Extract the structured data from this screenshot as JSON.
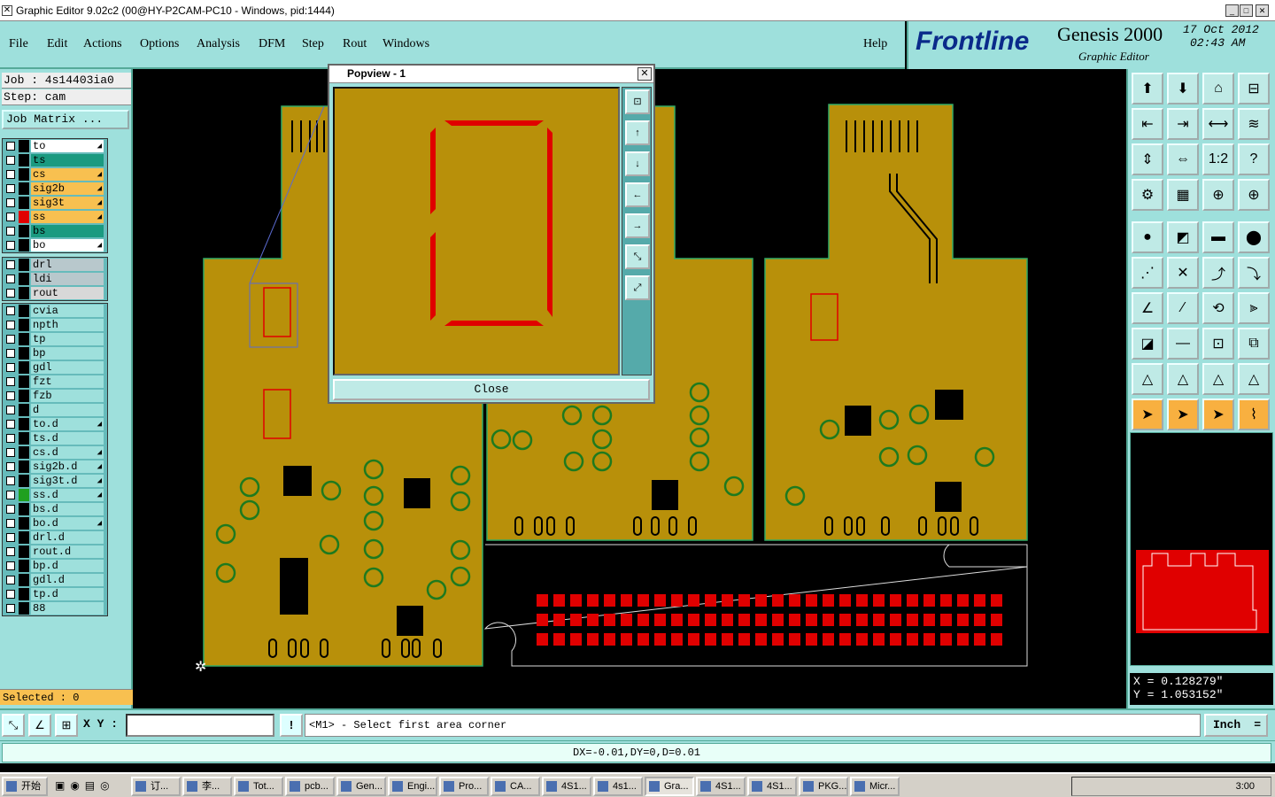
{
  "window": {
    "title": "Graphic Editor 9.02c2 (00@HY-P2CAM-PC10 - Windows, pid:1444)"
  },
  "menu": {
    "items": [
      "File",
      "Edit",
      "Actions",
      "Options",
      "Analysis",
      "DFM",
      "Step",
      "Rout",
      "Windows"
    ],
    "help": "Help"
  },
  "logo": {
    "brand": "Frontline",
    "product": "Genesis 2000",
    "subtitle": "Graphic Editor",
    "date": "17 Oct 2012",
    "time": "02:43 AM"
  },
  "job": {
    "job_label": "Job : 4s14403ia0",
    "step_label": "Step: cam",
    "matrix_button": "Job Matrix ..."
  },
  "layers": {
    "group1": [
      {
        "name": "to",
        "color": "#ffffff",
        "swatch": "#000000",
        "arrow": true
      },
      {
        "name": "ts",
        "color": "#1a9a80",
        "swatch": "#000000",
        "arrow": false
      },
      {
        "name": "cs",
        "color": "#f8c050",
        "swatch": "#000000",
        "arrow": true
      },
      {
        "name": "sig2b",
        "color": "#f8c050",
        "swatch": "#000000",
        "arrow": true
      },
      {
        "name": "sig3t",
        "color": "#f8c050",
        "swatch": "#000000",
        "arrow": true
      },
      {
        "name": "ss",
        "color": "#f8c050",
        "swatch": "#e00000",
        "arrow": true
      },
      {
        "name": "bs",
        "color": "#1a9a80",
        "swatch": "#000000",
        "arrow": false
      },
      {
        "name": "bo",
        "color": "#ffffff",
        "swatch": "#000000",
        "arrow": true
      }
    ],
    "group2": [
      {
        "name": "drl",
        "color": "#b8c8cc",
        "swatch": "#000000",
        "arrow": false
      },
      {
        "name": "ldi",
        "color": "#b8c8cc",
        "swatch": "#000000",
        "arrow": false
      },
      {
        "name": "rout",
        "color": "#d8d8d8",
        "swatch": "#000000",
        "arrow": false
      }
    ],
    "group3": [
      {
        "name": "cvia",
        "color": "#9ee0dc",
        "swatch": "#000000",
        "arrow": false
      },
      {
        "name": "npth",
        "color": "#9ee0dc",
        "swatch": "#000000",
        "arrow": false
      },
      {
        "name": "tp",
        "color": "#9ee0dc",
        "swatch": "#000000",
        "arrow": false
      },
      {
        "name": "bp",
        "color": "#9ee0dc",
        "swatch": "#000000",
        "arrow": false
      },
      {
        "name": "gdl",
        "color": "#9ee0dc",
        "swatch": "#000000",
        "arrow": false
      },
      {
        "name": "fzt",
        "color": "#9ee0dc",
        "swatch": "#000000",
        "arrow": false
      },
      {
        "name": "fzb",
        "color": "#9ee0dc",
        "swatch": "#000000",
        "arrow": false
      },
      {
        "name": "d",
        "color": "#9ee0dc",
        "swatch": "#000000",
        "arrow": false
      },
      {
        "name": "to.d",
        "color": "#9ee0dc",
        "swatch": "#000000",
        "arrow": true
      },
      {
        "name": "ts.d",
        "color": "#9ee0dc",
        "swatch": "#000000",
        "arrow": false
      },
      {
        "name": "cs.d",
        "color": "#9ee0dc",
        "swatch": "#000000",
        "arrow": true
      },
      {
        "name": "sig2b.d",
        "color": "#9ee0dc",
        "swatch": "#000000",
        "arrow": true
      },
      {
        "name": "sig3t.d",
        "color": "#9ee0dc",
        "swatch": "#000000",
        "arrow": true
      },
      {
        "name": "ss.d",
        "color": "#9ee0dc",
        "swatch": "#20a020",
        "arrow": true
      },
      {
        "name": "bs.d",
        "color": "#9ee0dc",
        "swatch": "#000000",
        "arrow": false
      },
      {
        "name": "bo.d",
        "color": "#9ee0dc",
        "swatch": "#000000",
        "arrow": true
      },
      {
        "name": "drl.d",
        "color": "#9ee0dc",
        "swatch": "#000000",
        "arrow": false
      },
      {
        "name": "rout.d",
        "color": "#9ee0dc",
        "swatch": "#000000",
        "arrow": false
      },
      {
        "name": "bp.d",
        "color": "#9ee0dc",
        "swatch": "#000000",
        "arrow": false
      },
      {
        "name": "gdl.d",
        "color": "#9ee0dc",
        "swatch": "#000000",
        "arrow": false
      },
      {
        "name": "tp.d",
        "color": "#9ee0dc",
        "swatch": "#000000",
        "arrow": false
      },
      {
        "name": "88",
        "color": "#9ee0dc",
        "swatch": "#000000",
        "arrow": false
      }
    ]
  },
  "selected": "Selected : 0",
  "popview": {
    "title": "Popview - 1",
    "close_label": "Close"
  },
  "coords": {
    "x": "X = 0.128279\"",
    "y": "Y = 1.053152\""
  },
  "bottom": {
    "xy_label": "X Y :",
    "xy_value": "",
    "prompt": "<M1> - Select first area corner",
    "unit": "Inch",
    "status": "DX=-0.01,DY=0,D=0.01"
  },
  "taskbar": {
    "start": "开始",
    "tasks": [
      "订...",
      "李...",
      "Tot...",
      "pcb...",
      "Gen...",
      "Engi...",
      "Pro...",
      "CA...",
      "4S1...",
      "4s1...",
      "Gra...",
      "4S1...",
      "4S1...",
      "PKG...",
      "Micr..."
    ],
    "clock": "3:00"
  },
  "colors": {
    "panel": "#9ee0dc",
    "board": "#b8900a",
    "copper_red": "#e00000",
    "pad_green": "#1e7a1e"
  }
}
